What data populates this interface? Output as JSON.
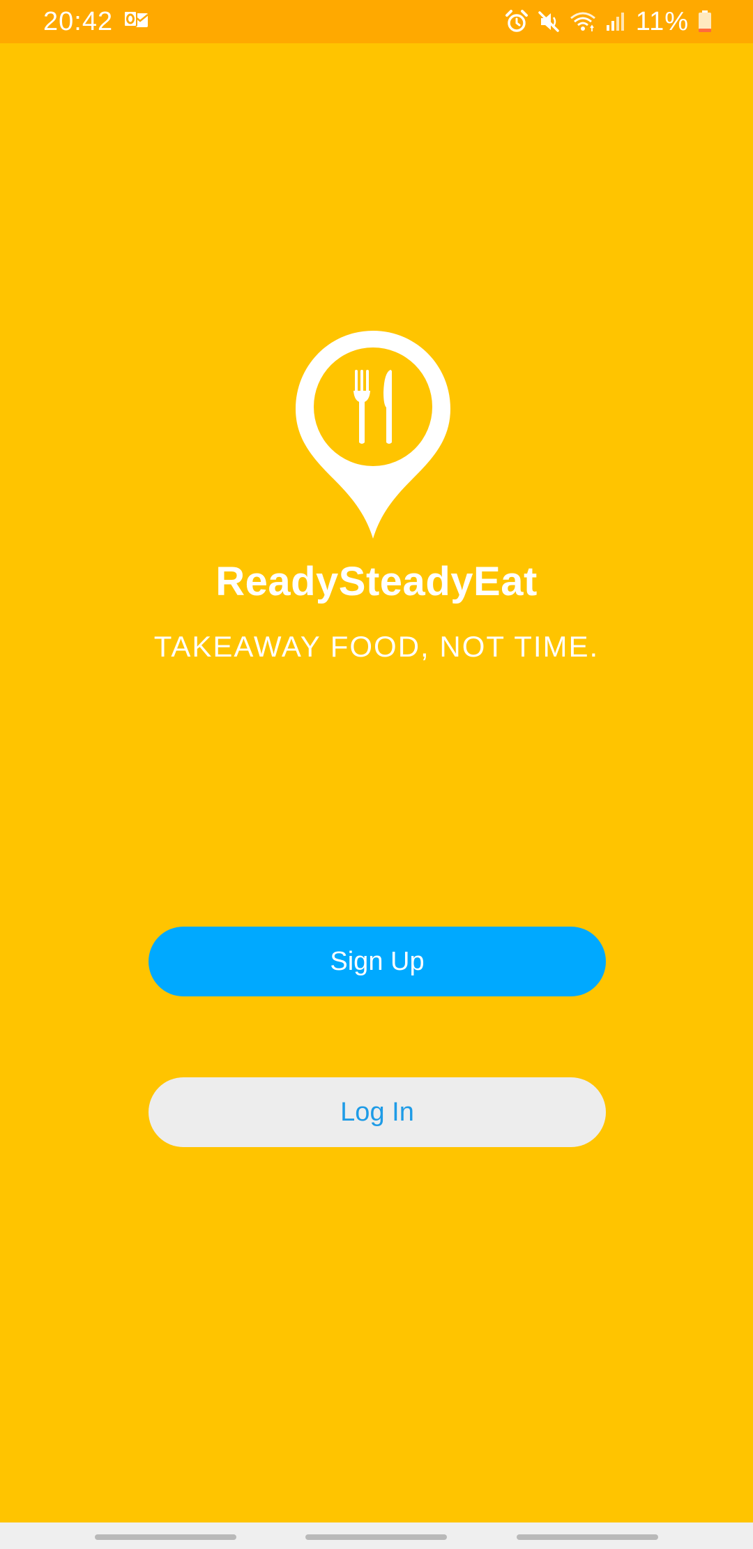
{
  "status_bar": {
    "time": "20:42",
    "battery_percent": "11%",
    "icons": [
      "outlook-notification-icon",
      "alarm-icon",
      "mute-icon",
      "wifi-icon",
      "signal-icon",
      "battery-icon"
    ]
  },
  "app": {
    "name": "ReadySteadyEat",
    "tagline": "TAKEAWAY FOOD, NOT TIME.",
    "logo_icon": "location-pin-fork-knife-icon"
  },
  "buttons": {
    "signup_label": "Sign Up",
    "login_label": "Log In"
  },
  "colors": {
    "background": "#FFC400",
    "status_bar": "#FFA900",
    "primary_button": "#00A9FF",
    "secondary_button": "#EDEDED",
    "secondary_button_text": "#1E9BE6"
  },
  "nav_bar": {
    "handles": [
      "recent-apps-handle",
      "home-handle",
      "back-handle"
    ]
  }
}
